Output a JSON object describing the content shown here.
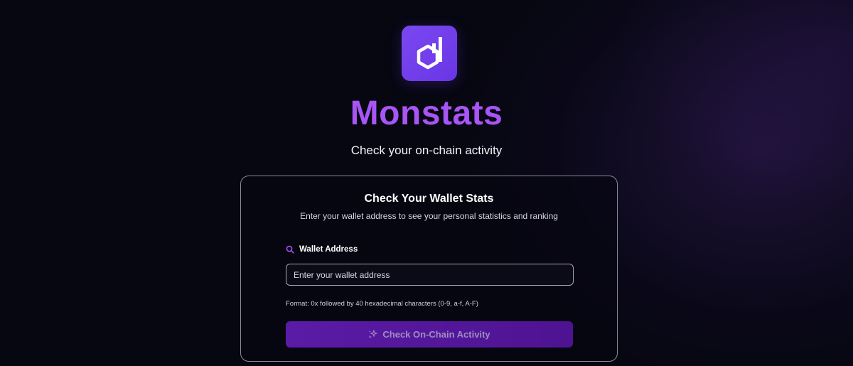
{
  "brand": {
    "name": "Monstats",
    "tagline": "Check your on-chain activity",
    "logo_icon": "monad-hexagon-logo-icon",
    "accent_color": "#a755f4",
    "logo_bg_color": "#7a48f0"
  },
  "card": {
    "title": "Check Your Wallet Stats",
    "subtitle": "Enter your wallet address to see your personal statistics and ranking",
    "wallet_field": {
      "icon": "search-icon",
      "label": "Wallet Address",
      "placeholder": "Enter your wallet address",
      "value": ""
    },
    "format_hint": "Format: 0x followed by 40 hexadecimal characters (0-9, a-f, A-F)",
    "submit": {
      "icon": "sparkles-icon",
      "label": "Check On-Chain Activity",
      "disabled": true,
      "color": "#5a1ba6"
    }
  }
}
